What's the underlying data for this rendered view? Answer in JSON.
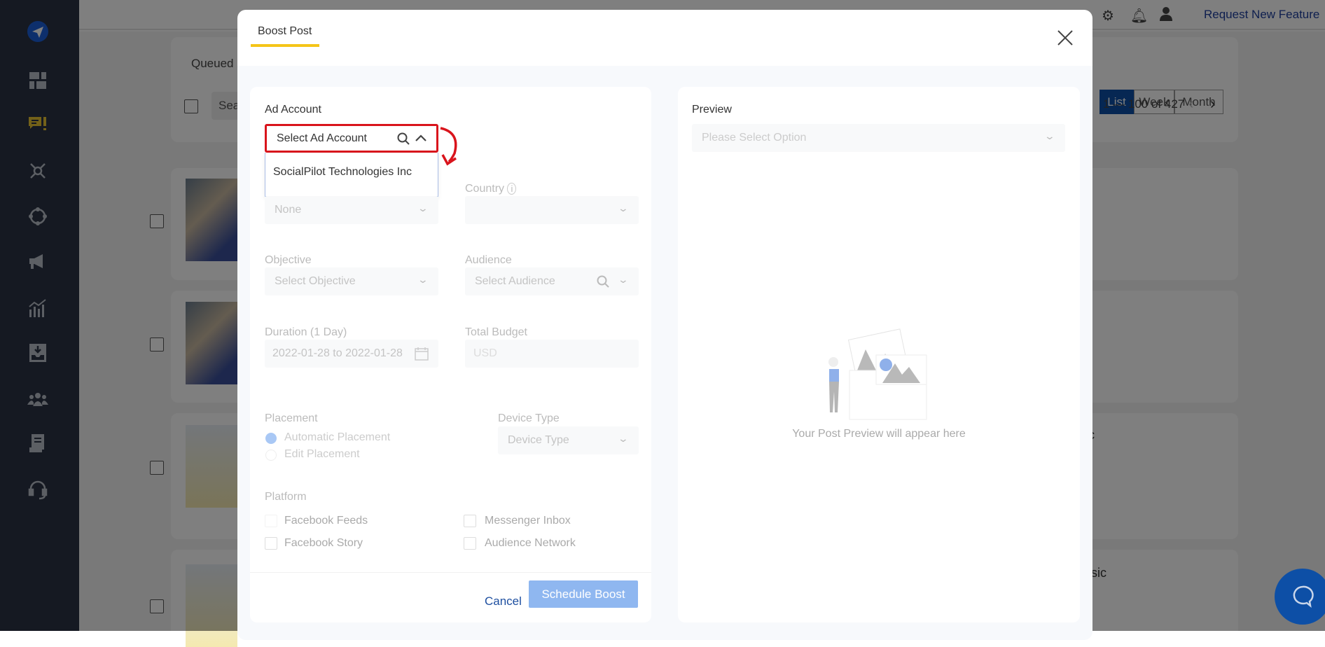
{
  "sidebar": {
    "items": [
      {
        "icon": "paper-plane-logo-icon"
      },
      {
        "icon": "dashboard-icon"
      },
      {
        "icon": "posts-icon",
        "active": true
      },
      {
        "icon": "network-icon"
      },
      {
        "icon": "connect-icon"
      },
      {
        "icon": "megaphone-icon"
      },
      {
        "icon": "analytics-icon"
      },
      {
        "icon": "inbox-download-icon"
      },
      {
        "icon": "team-icon"
      },
      {
        "icon": "reports-icon"
      },
      {
        "icon": "support-headset-icon"
      }
    ],
    "accent": "#e6c233"
  },
  "topbar": {
    "request_feature": "Request New Feature"
  },
  "background": {
    "queued_label": "Queued P",
    "search_placeholder": "Sea",
    "views": [
      "List",
      "Week",
      "Month"
    ],
    "active_view": "List",
    "pagination": "1 — 100 of 427",
    "row_text_fragments": [
      "ic",
      "usic"
    ]
  },
  "modal": {
    "tab": "Boost Post",
    "tab_color": "#f5c518",
    "ad_account": {
      "label": "Ad Account",
      "placeholder": "Select Ad Account",
      "options": [
        "SocialPilot Technologies Inc"
      ]
    },
    "page": {
      "value": "None"
    },
    "country": {
      "label": "Country"
    },
    "objective": {
      "label": "Objective",
      "placeholder": "Select Objective"
    },
    "audience": {
      "label": "Audience",
      "placeholder": "Select Audience"
    },
    "duration": {
      "label": "Duration (1 Day)",
      "value": "2022-01-28 to 2022-01-28"
    },
    "budget": {
      "label": "Total Budget",
      "currency": "USD"
    },
    "placement": {
      "label": "Placement",
      "options": [
        "Automatic Placement",
        "Edit Placement"
      ],
      "selected": "Automatic Placement"
    },
    "device_type": {
      "label": "Device Type",
      "placeholder": "Device Type"
    },
    "platform": {
      "label": "Platform",
      "options": [
        "Facebook Feeds",
        "Messenger Inbox",
        "Facebook Story",
        "Audience Network"
      ]
    },
    "cancel": "Cancel",
    "submit": "Schedule Boost",
    "preview": {
      "label": "Preview",
      "placeholder": "Please Select Option",
      "empty_text": "Your Post Preview will appear here"
    }
  },
  "colors": {
    "brand": "#0d4fa6",
    "highlight": "#d9141c",
    "button_disabled": "#8fb7f0"
  }
}
